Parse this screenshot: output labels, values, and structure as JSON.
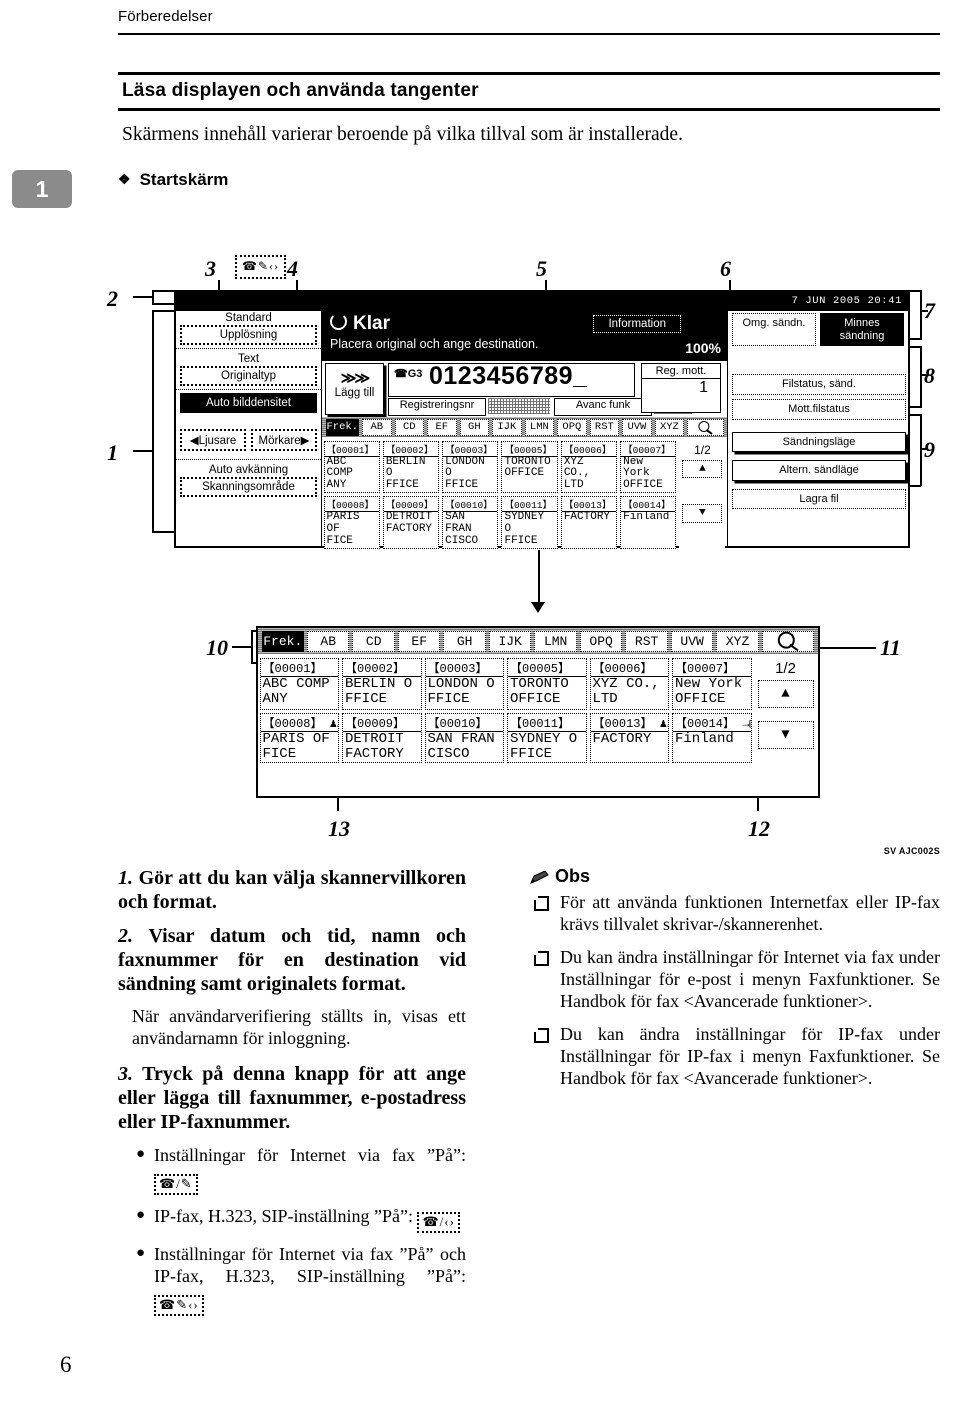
{
  "page": {
    "running_head": "Förberedelser",
    "chapter_tab": "1",
    "section_title": "Läsa displayen och använda tangenter",
    "lead": "Skärmens innehåll varierar beroende på vilka tillval som är installerade.",
    "diamond_heading": "Startskärm",
    "folio": "6",
    "figure_credit": "SV AJC002S"
  },
  "figure": {
    "callouts": [
      "1",
      "2",
      "3",
      "4",
      "5",
      "6",
      "7",
      "8",
      "9",
      "10",
      "11",
      "12",
      "13"
    ],
    "key_icon_3": "☎✎‹›",
    "lcd": {
      "datetime": "7 JUN  2005 20:41",
      "left_panel": {
        "resolution_value": "Standard",
        "resolution_label": "Upplösning",
        "original_type_value": "Text",
        "original_type_label": "Originaltyp",
        "auto_density": "Auto bilddensitet",
        "lighter": "◀Ljusare",
        "darker": "Mörkare▶",
        "auto_detect": "Auto avkänning",
        "scan_area": "Skanningsområde"
      },
      "status": {
        "ready": "Klar",
        "instruction": "Placera original och ange destination.",
        "information": "Information",
        "zoom": "100%"
      },
      "entry": {
        "add_button": "Lägg till",
        "add_chevrons": "≫≫",
        "line_label": "G3",
        "number": "0123456789_",
        "register_button": "Registreringsnr",
        "advanced_button": "Avanc funk",
        "reg_recv_label": "Reg. mott.",
        "reg_recv_count": "1"
      },
      "right_panel": {
        "immediate_tx": "Omg. sändn.",
        "memory_tx": "Minnes sändning",
        "tx_file_status": "Filstatus, sänd.",
        "rx_file_status": "Mott.filstatus",
        "tx_mode": "Sändningsläge",
        "alt_tx_mode": "Altern. sändläge",
        "store_file": "Lagra fil"
      },
      "tabs": [
        "Frek.",
        "AB",
        "CD",
        "EF",
        "GH",
        "IJK",
        "LMN",
        "OPQ",
        "RST",
        "UVW",
        "XYZ"
      ],
      "search_icon": "magnifier-icon",
      "page_indicator": "1/2",
      "scroll_up": "▲",
      "scroll_down": "▼",
      "destinations_row1": [
        {
          "id": "【00001】",
          "name": "ABC COMP\nANY"
        },
        {
          "id": "【00002】",
          "name": "BERLIN O\nFFICE"
        },
        {
          "id": "【00003】",
          "name": "LONDON O\nFFICE"
        },
        {
          "id": "【00005】",
          "name": "TORONTO\nOFFICE"
        },
        {
          "id": "【00006】",
          "name": "XYZ CO.,\n LTD"
        },
        {
          "id": "【00007】",
          "name": "New York\n OFFICE"
        }
      ],
      "destinations_row2": [
        {
          "id": "【00008】",
          "badge": "group-icon",
          "name": "PARIS OF\nFICE"
        },
        {
          "id": "【00009】",
          "badge": "",
          "name": "DETROIT\nFACTORY"
        },
        {
          "id": "【00010】",
          "badge": "",
          "name": "SAN FRAN\nCISCO"
        },
        {
          "id": "【00011】",
          "badge": "",
          "name": "SYDNEY O\nFFICE"
        },
        {
          "id": "【00013】",
          "badge": "group-icon",
          "name": "FACTORY"
        },
        {
          "id": "【00014】",
          "badge": "folder-icon",
          "name": "Finland"
        }
      ]
    }
  },
  "body": {
    "items": [
      {
        "num": "1.",
        "text": "Gör att du kan välja skannervillkoren och format."
      },
      {
        "num": "2.",
        "text": "Visar datum och tid, namn och faxnummer för en destination vid sändning samt originalets format.",
        "sub": "När användarverifiering ställts in, visas ett användarnamn för inloggning."
      },
      {
        "num": "3.",
        "text": "Tryck på denna knapp för att ange eller lägga till faxnummer, e-postadress eller IP-faxnummer."
      }
    ],
    "bullets": [
      {
        "text": "Inställningar för Internet via fax ”På”:",
        "icon": "☎/✎"
      },
      {
        "text": "IP-fax, H.323, SIP-inställning ”På”:",
        "icon": "☎/‹›"
      },
      {
        "text": "Inställningar för Internet via fax ”På” och IP-fax, H.323, SIP-inställning ”På”:",
        "icon": "☎✎‹›"
      }
    ],
    "note": {
      "title": "Obs",
      "items": [
        "För att använda funktionen Internetfax eller IP-fax krävs tillvalet skrivar-/skannerenhet.",
        "Du kan ändra inställningar för Internet via fax under Inställningar för e-post i menyn Faxfunktioner. Se Handbok för fax <Avancerade funktioner>.",
        "Du kan ändra inställningar för IP-fax under Inställningar för IP-fax i menyn Faxfunktioner. Se Handbok för fax <Avancerade funktioner>."
      ]
    }
  }
}
